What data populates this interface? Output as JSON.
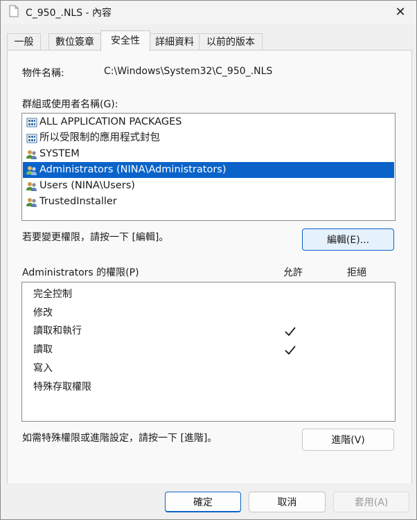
{
  "window": {
    "title": "C_950_.NLS - 內容",
    "close_glyph": "✕"
  },
  "tabs": [
    {
      "label": "一般"
    },
    {
      "label": "數位簽章"
    },
    {
      "label": "安全性"
    },
    {
      "label": "詳細資料"
    },
    {
      "label": "以前的版本"
    }
  ],
  "active_tab": "安全性",
  "security": {
    "object_name_label": "物件名稱:",
    "object_name_value": "C:\\Windows\\System32\\C_950_.NLS",
    "groups_label": "群組或使用者名稱(G):",
    "users": [
      {
        "label": "ALL APPLICATION PACKAGES",
        "icon": "app-package-icon",
        "selected": false
      },
      {
        "label": "所以受限制的應用程式封包",
        "icon": "app-package-icon",
        "selected": false
      },
      {
        "label": "SYSTEM",
        "icon": "user-group-icon",
        "selected": false
      },
      {
        "label": "Administrators (NINA\\Administrators)",
        "icon": "user-group-icon",
        "selected": true
      },
      {
        "label": "Users (NINA\\Users)",
        "icon": "user-group-icon",
        "selected": false
      },
      {
        "label": "TrustedInstaller",
        "icon": "user-group-icon",
        "selected": false
      }
    ],
    "change_hint": "若要變更權限，請按一下 [編輯]。",
    "edit_button": "編輯(E)...",
    "permissions_label": "Administrators 的權限(P)",
    "allow_header": "允許",
    "deny_header": "拒絕",
    "permissions": [
      {
        "name": "完全控制",
        "allow": false,
        "deny": false
      },
      {
        "name": "修改",
        "allow": false,
        "deny": false
      },
      {
        "name": "讀取和執行",
        "allow": true,
        "deny": false
      },
      {
        "name": "讀取",
        "allow": true,
        "deny": false
      },
      {
        "name": "寫入",
        "allow": false,
        "deny": false
      },
      {
        "name": "特殊存取權限",
        "allow": false,
        "deny": false
      }
    ],
    "advanced_hint": "如需特殊權限或進階設定，請按一下 [進階]。",
    "advanced_button": "進階(V)"
  },
  "footer": {
    "ok_button": "確定",
    "cancel_button": "取消",
    "apply_button": "套用(A)"
  },
  "colors": {
    "selection": "#0a63c9",
    "accent_button_bg": "#e5f1fb"
  }
}
